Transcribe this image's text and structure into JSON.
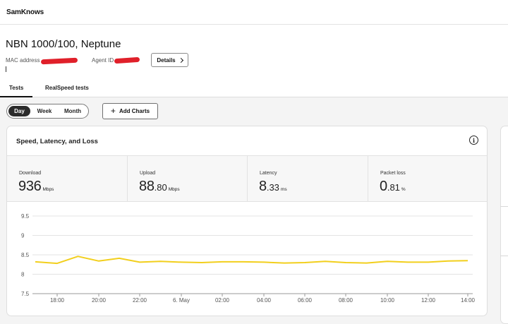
{
  "app": {
    "brand": "SamKnows"
  },
  "agent": {
    "title": "NBN 1000/100, Neptune",
    "mac_label": "MAC address",
    "agent_id_label": "Agent ID",
    "details_label": "Details"
  },
  "tabs": [
    {
      "label": "Tests",
      "active": true
    },
    {
      "label": "RealSpeed tests",
      "active": false
    }
  ],
  "range": [
    {
      "label": "Day",
      "active": true
    },
    {
      "label": "Week",
      "active": false
    },
    {
      "label": "Month",
      "active": false
    }
  ],
  "add_charts_label": "Add Charts",
  "card": {
    "title": "Speed, Latency, and Loss",
    "metrics": [
      {
        "label": "Download",
        "int": "936",
        "dec": "",
        "unit": "Mbps"
      },
      {
        "label": "Upload",
        "int": "88",
        "dec": ".80",
        "unit": "Mbps"
      },
      {
        "label": "Latency",
        "int": "8",
        "dec": ".33",
        "unit": "ms"
      },
      {
        "label": "Packet loss",
        "int": "0",
        "dec": ".81",
        "unit": "%"
      }
    ]
  },
  "colors": {
    "series": "#f2cf1d",
    "grid": "#e3e3e3",
    "accent_redaction": "#e0202a"
  },
  "chart_data": {
    "type": "line",
    "x_ticks": [
      "18:00",
      "20:00",
      "22:00",
      "6. May",
      "02:00",
      "04:00",
      "06:00",
      "08:00",
      "10:00",
      "12:00",
      "14:00"
    ],
    "y_ticks": [
      "9.5",
      "9",
      "8.5",
      "8",
      "7.5"
    ],
    "ylim": [
      7.5,
      9.5
    ],
    "x_hours": [
      17,
      18,
      19,
      20,
      21,
      22,
      23,
      24,
      25,
      26,
      27,
      28,
      29,
      30,
      31,
      32,
      33,
      34,
      35,
      36,
      37,
      38
    ],
    "series": [
      {
        "values": [
          8.32,
          8.28,
          8.46,
          8.34,
          8.41,
          8.31,
          8.33,
          8.31,
          8.3,
          8.32,
          8.32,
          8.31,
          8.29,
          8.3,
          8.33,
          8.3,
          8.29,
          8.33,
          8.31,
          8.31,
          8.34,
          8.35
        ]
      }
    ],
    "grid": true
  }
}
